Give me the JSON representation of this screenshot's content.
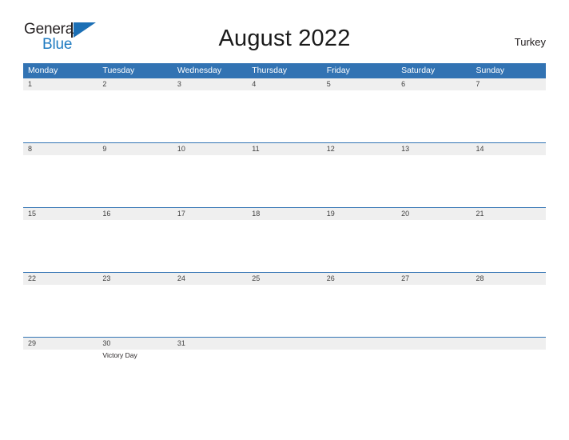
{
  "brand": {
    "name_part1": "General",
    "name_part2": "Blue",
    "mark": "triangle-flag-icon",
    "accent_color": "#1b6fb5"
  },
  "header": {
    "title": "August 2022",
    "country": "Turkey"
  },
  "theme": {
    "header_blue": "#3273b3",
    "row_band_gray": "#efefef",
    "divider_blue": "#3273b3",
    "text_dark": "#231f20"
  },
  "calendar": {
    "month": "August",
    "year": "2022",
    "weekday_headers": [
      "Monday",
      "Tuesday",
      "Wednesday",
      "Thursday",
      "Friday",
      "Saturday",
      "Sunday"
    ],
    "weeks": [
      {
        "days": [
          {
            "date": "1",
            "events": []
          },
          {
            "date": "2",
            "events": []
          },
          {
            "date": "3",
            "events": []
          },
          {
            "date": "4",
            "events": []
          },
          {
            "date": "5",
            "events": []
          },
          {
            "date": "6",
            "events": []
          },
          {
            "date": "7",
            "events": []
          }
        ]
      },
      {
        "days": [
          {
            "date": "8",
            "events": []
          },
          {
            "date": "9",
            "events": []
          },
          {
            "date": "10",
            "events": []
          },
          {
            "date": "11",
            "events": []
          },
          {
            "date": "12",
            "events": []
          },
          {
            "date": "13",
            "events": []
          },
          {
            "date": "14",
            "events": []
          }
        ]
      },
      {
        "days": [
          {
            "date": "15",
            "events": []
          },
          {
            "date": "16",
            "events": []
          },
          {
            "date": "17",
            "events": []
          },
          {
            "date": "18",
            "events": []
          },
          {
            "date": "19",
            "events": []
          },
          {
            "date": "20",
            "events": []
          },
          {
            "date": "21",
            "events": []
          }
        ]
      },
      {
        "days": [
          {
            "date": "22",
            "events": []
          },
          {
            "date": "23",
            "events": []
          },
          {
            "date": "24",
            "events": []
          },
          {
            "date": "25",
            "events": []
          },
          {
            "date": "26",
            "events": []
          },
          {
            "date": "27",
            "events": []
          },
          {
            "date": "28",
            "events": []
          }
        ]
      },
      {
        "days": [
          {
            "date": "29",
            "events": []
          },
          {
            "date": "30",
            "events": [
              "Victory Day"
            ]
          },
          {
            "date": "31",
            "events": []
          },
          {
            "date": "",
            "events": []
          },
          {
            "date": "",
            "events": []
          },
          {
            "date": "",
            "events": []
          },
          {
            "date": "",
            "events": []
          }
        ]
      }
    ]
  }
}
